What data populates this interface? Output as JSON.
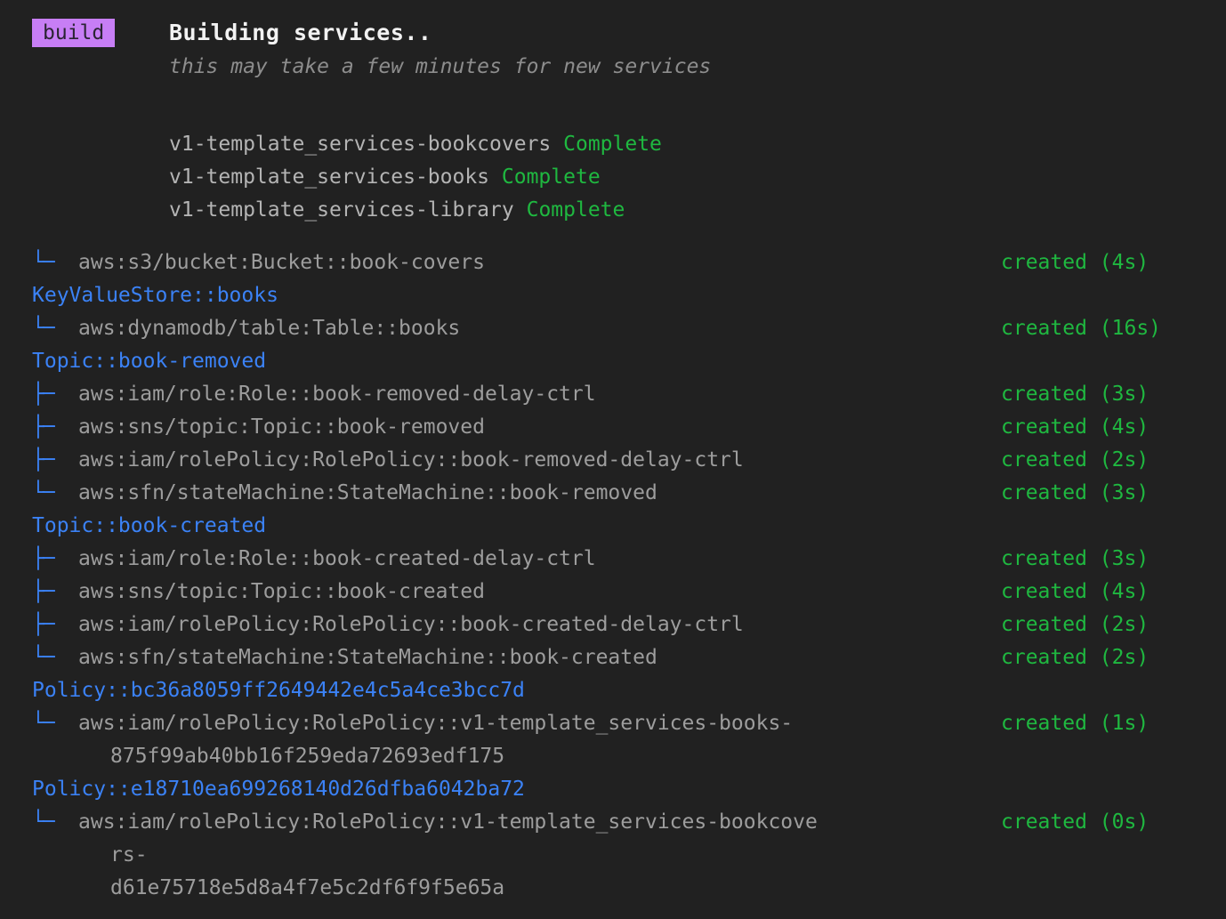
{
  "terminal": {
    "background": "#212121",
    "accent_badge": "#c77ef5",
    "accent_blue": "#3b82f6",
    "accent_green": "#1fb840",
    "text_gray": "#9d9d9d"
  },
  "header": {
    "badge_label": "build",
    "title": "Building services..",
    "subtitle": "this may take a few minutes for new services"
  },
  "services": [
    {
      "name": "v1-template_services-bookcovers",
      "status": "Complete"
    },
    {
      "name": "v1-template_services-books",
      "status": "Complete"
    },
    {
      "name": "v1-template_services-library",
      "status": "Complete"
    }
  ],
  "tree": {
    "groups": [
      {
        "header": "",
        "rows": [
          {
            "branch": "└─",
            "resource": "aws:s3/bucket:Bucket::book-covers",
            "continuation": "",
            "status": "created (4s)"
          }
        ]
      },
      {
        "header": "KeyValueStore::books",
        "rows": [
          {
            "branch": "└─",
            "resource": "aws:dynamodb/table:Table::books",
            "continuation": "",
            "status": "created (16s)"
          }
        ]
      },
      {
        "header": "Topic::book-removed",
        "rows": [
          {
            "branch": "├─",
            "resource": "aws:iam/role:Role::book-removed-delay-ctrl",
            "continuation": "",
            "status": "created (3s)"
          },
          {
            "branch": "├─",
            "resource": "aws:sns/topic:Topic::book-removed",
            "continuation": "",
            "status": "created (4s)"
          },
          {
            "branch": "├─",
            "resource": "aws:iam/rolePolicy:RolePolicy::book-removed-delay-ctrl",
            "continuation": "",
            "status": "created (2s)"
          },
          {
            "branch": "└─",
            "resource": "aws:sfn/stateMachine:StateMachine::book-removed",
            "continuation": "",
            "status": "created (3s)"
          }
        ]
      },
      {
        "header": "Topic::book-created",
        "rows": [
          {
            "branch": "├─",
            "resource": "aws:iam/role:Role::book-created-delay-ctrl",
            "continuation": "",
            "status": "created (3s)"
          },
          {
            "branch": "├─",
            "resource": "aws:sns/topic:Topic::book-created",
            "continuation": "",
            "status": "created (4s)"
          },
          {
            "branch": "├─",
            "resource": "aws:iam/rolePolicy:RolePolicy::book-created-delay-ctrl",
            "continuation": "",
            "status": "created (2s)"
          },
          {
            "branch": "└─",
            "resource": "aws:sfn/stateMachine:StateMachine::book-created",
            "continuation": "",
            "status": "created (2s)"
          }
        ]
      },
      {
        "header": "Policy::bc36a8059ff2649442e4c5a4ce3bcc7d",
        "rows": [
          {
            "branch": "└─",
            "resource": "aws:iam/rolePolicy:RolePolicy::v1-template_services-books-",
            "continuation": "875f99ab40bb16f259eda72693edf175",
            "status": "created (1s)"
          }
        ]
      },
      {
        "header": "Policy::e18710ea699268140d26dfba6042ba72",
        "rows": [
          {
            "branch": "└─",
            "resource": "aws:iam/rolePolicy:RolePolicy::v1-template_services-bookcove",
            "continuation": "rs-\nd61e75718e5d8a4f7e5c2df6f9f5e65a",
            "status": "created (0s)"
          }
        ]
      }
    ]
  }
}
